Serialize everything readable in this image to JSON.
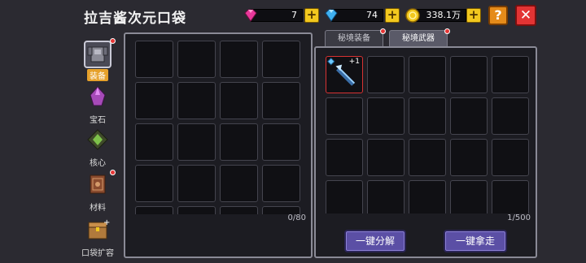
{
  "header": {
    "title": "拉吉酱次元口袋",
    "resources": [
      {
        "name": "pink-gem",
        "value": "7",
        "color": "#e8389a"
      },
      {
        "name": "blue-gem",
        "value": "74",
        "color": "#3fb0f0"
      },
      {
        "name": "gold-coin",
        "value": "338.1万",
        "color": "#f2c81e"
      }
    ],
    "help_label": "?",
    "close_label": "✕"
  },
  "sidebar": {
    "items": [
      {
        "label": "装备",
        "icon": "armor-icon",
        "active": true,
        "dot": true
      },
      {
        "label": "宝石",
        "icon": "crystal-icon",
        "active": false,
        "dot": false
      },
      {
        "label": "核心",
        "icon": "core-icon",
        "active": false,
        "dot": false
      },
      {
        "label": "材料",
        "icon": "book-icon",
        "active": false,
        "dot": true
      },
      {
        "label": "口袋扩容",
        "icon": "chest-icon",
        "active": false,
        "dot": false
      }
    ]
  },
  "left_panel": {
    "count": "0/80"
  },
  "right_panel": {
    "tabs": [
      {
        "label": "秘境装备",
        "active": false
      },
      {
        "label": "秘境武器",
        "active": true
      }
    ],
    "count": "1/500",
    "items": [
      {
        "icon": "staff-weapon-icon",
        "level": "+1",
        "rarity_color": "#6cc9ff"
      }
    ],
    "buttons": {
      "decompose": "一键分解",
      "take_all": "一键拿走"
    }
  }
}
